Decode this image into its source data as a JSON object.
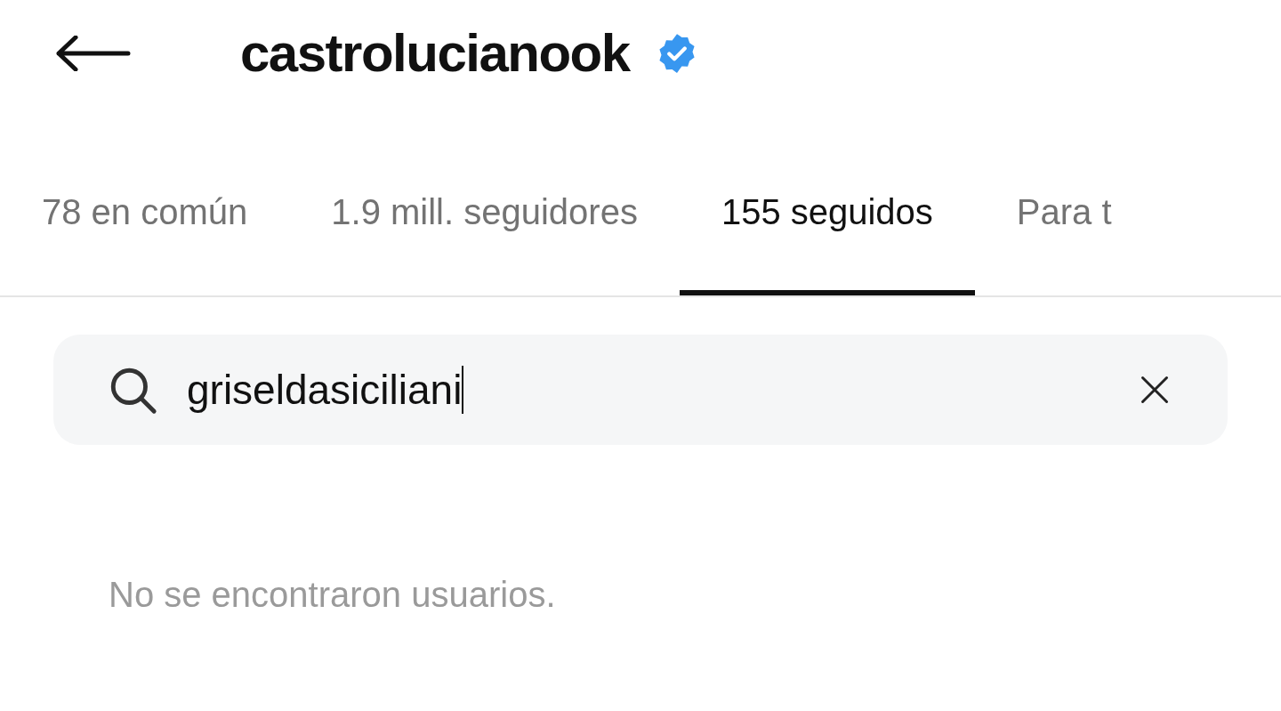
{
  "header": {
    "username": "castrolucianook",
    "verified": true
  },
  "tabs": [
    {
      "label": "78 en común",
      "selected": false
    },
    {
      "label": "1.9 mill. seguidores",
      "selected": false
    },
    {
      "label": "155 seguidos",
      "selected": true
    },
    {
      "label": "Para t",
      "selected": false
    }
  ],
  "search": {
    "value": "griseldasiciliani"
  },
  "empty_message": "No se encontraron usuarios."
}
